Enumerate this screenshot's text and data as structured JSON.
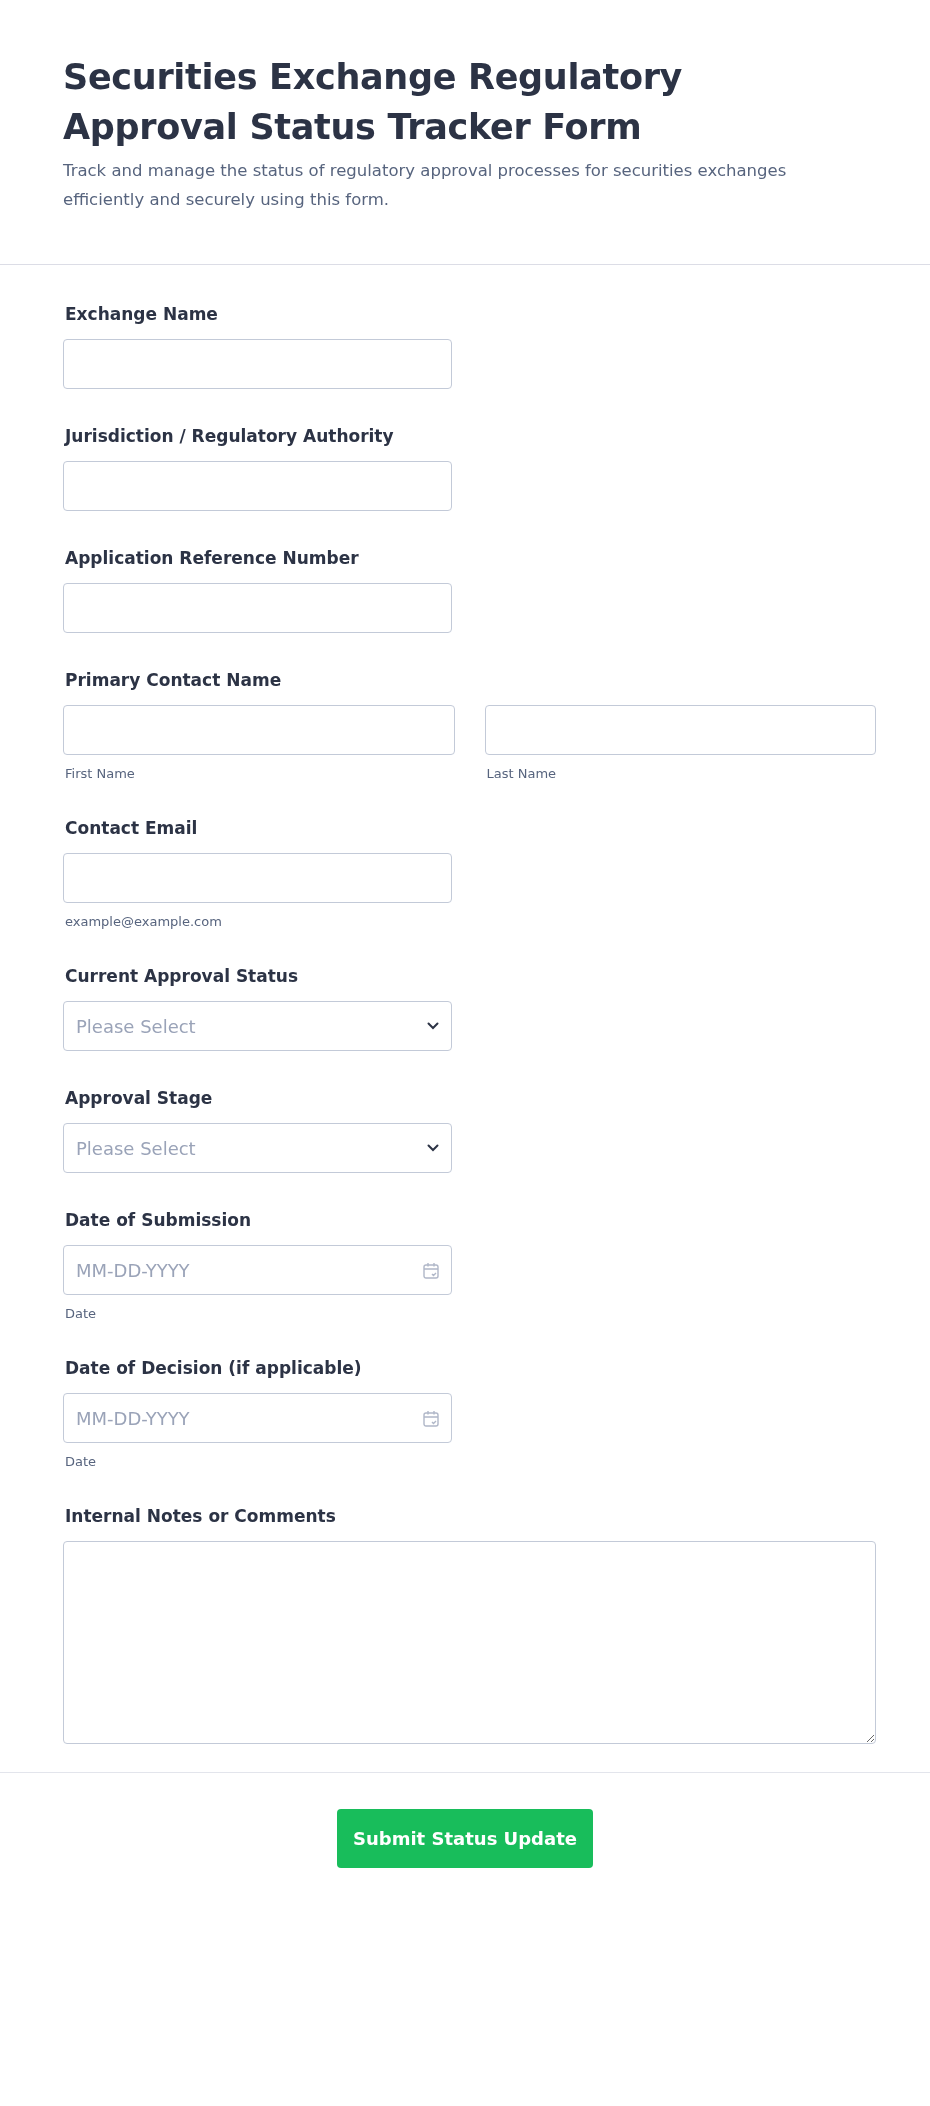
{
  "header": {
    "title": "Securities Exchange Regulatory Approval Status Tracker Form",
    "description": "Track and manage the status of regulatory approval processes for securities exchanges efficiently and securely using this form."
  },
  "fields": [
    {
      "kind": "text",
      "label": "Exchange Name"
    },
    {
      "kind": "text",
      "label": "Jurisdiction / Regulatory Authority"
    },
    {
      "kind": "text",
      "label": "Application Reference Number"
    },
    {
      "kind": "name",
      "label": "Primary Contact Name",
      "parts": [
        {
          "sublabel": "First Name"
        },
        {
          "sublabel": "Last Name"
        }
      ]
    },
    {
      "kind": "email",
      "label": "Contact Email",
      "sublabel": "example@example.com"
    },
    {
      "kind": "select",
      "label": "Current Approval Status",
      "placeholder": "Please Select"
    },
    {
      "kind": "select",
      "label": "Approval Stage",
      "placeholder": "Please Select"
    },
    {
      "kind": "date",
      "label": "Date of Submission",
      "placeholder": "MM-DD-YYYY",
      "sublabel": "Date"
    },
    {
      "kind": "date",
      "label": "Date of Decision (if applicable)",
      "placeholder": "MM-DD-YYYY",
      "sublabel": "Date"
    },
    {
      "kind": "textarea",
      "label": "Internal Notes or Comments"
    }
  ],
  "submit": {
    "label": "Submit Status Update"
  }
}
